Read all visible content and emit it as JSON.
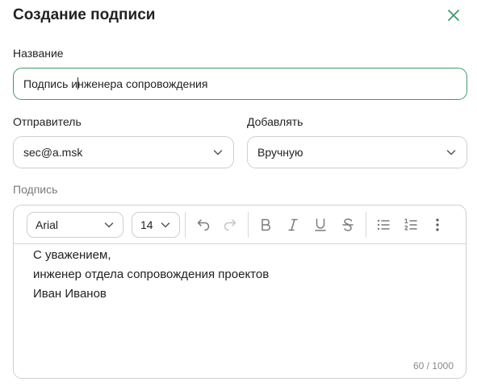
{
  "dialog": {
    "title": "Создание подписи",
    "close_icon": "close-icon"
  },
  "name_field": {
    "label": "Название",
    "value_before_caret": "Подпись и",
    "value_after_caret": "нженера сопровождения"
  },
  "sender": {
    "label": "Отправитель",
    "value": "sec@a.msk"
  },
  "add_mode": {
    "label": "Добавлять",
    "value": "Вручную"
  },
  "signature": {
    "label": "Подпись",
    "toolbar": {
      "font": "Arial",
      "size": "14",
      "icons": [
        "undo-icon",
        "redo-icon",
        "bold-icon",
        "italic-icon",
        "underline-icon",
        "strikethrough-icon",
        "bullet-list-icon",
        "numbered-list-icon",
        "more-icon"
      ]
    },
    "lines": [
      "С уважением,",
      "инженер отдела сопровождения проектов",
      "Иван Иванов"
    ],
    "counter": "60 / 1000"
  },
  "colors": {
    "accent": "#3f9a6e",
    "border": "#cfcfcf",
    "icon": "#7a7a7a",
    "icon_disabled": "#c4c4c4"
  }
}
